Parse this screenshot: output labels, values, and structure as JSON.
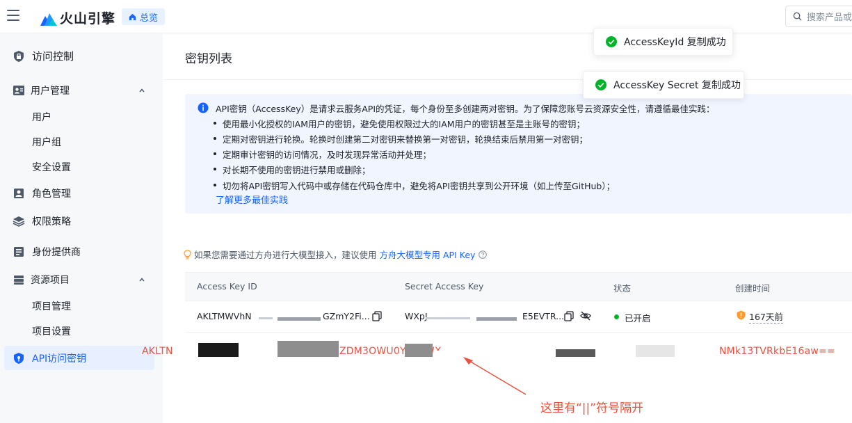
{
  "header": {
    "brand": "火山引擎",
    "overview_label": "总览",
    "search_placeholder": "搜索产品或"
  },
  "sidebar": {
    "access_control": "访问控制",
    "user_mgmt": "用户管理",
    "users": "用户",
    "user_groups": "用户组",
    "security_settings": "安全设置",
    "role_mgmt": "角色管理",
    "policies": "权限策略",
    "identity_providers": "身份提供商",
    "resource_projects": "资源项目",
    "project_mgmt": "项目管理",
    "project_settings": "项目设置",
    "api_keys": "API访问密钥"
  },
  "page": {
    "title": "密钥列表",
    "info_head": "API密钥（AccessKey）是请求云服务API的凭证，每个身份至多创建两对密钥。为了保障您账号云资源安全性，请遵循最佳实践：",
    "info_items": [
      "使用最小化授权的IAM用户的密钥，避免使用权限过大的IAM用户的密钥甚至是主账号的密钥；",
      "定期对密钥进行轮换。轮换时创建第二对密钥来替换第一对密钥，轮换结束后禁用第一对密钥；",
      "定期审计密钥的访问情况，及时发现异常活动并处理；",
      "对长期不使用的密钥进行禁用或删除；",
      "切勿将API密钥写入代码中或存储在代码仓库中，避免将API密钥共享到公开环境（如上传至GitHub）；"
    ],
    "info_link": "了解更多最佳实践",
    "tip_text": "如果您需要通过方舟进行大模型接入，建议使用",
    "tip_link": "方舟大模型专用 API Key"
  },
  "table": {
    "headers": [
      "Access Key ID",
      "Secret Access Key",
      "状态",
      "创建时间"
    ],
    "row": {
      "akid_start": "AKLTMWVhN",
      "akid_end": "GZmY2Fi...",
      "secret_start": "WXpJ",
      "secret_end": "E5EVTR...",
      "status": "已开启",
      "created": "167天前"
    }
  },
  "paste": {
    "left": "AKLTN",
    "middle": "ZDM3OWU0YzA||WX",
    "right": "NMk13TVRkbE16aw=="
  },
  "annotation": "这里有“||”符号隔开",
  "toasts": {
    "akid_copied": "AccessKeyId 复制成功",
    "secret_copied": "AccessKey Secret 复制成功"
  },
  "colors": {
    "primary": "#1664ff",
    "success": "#00b42a",
    "annotation_red": "#e8523f",
    "warning": "#ff9a2e"
  }
}
